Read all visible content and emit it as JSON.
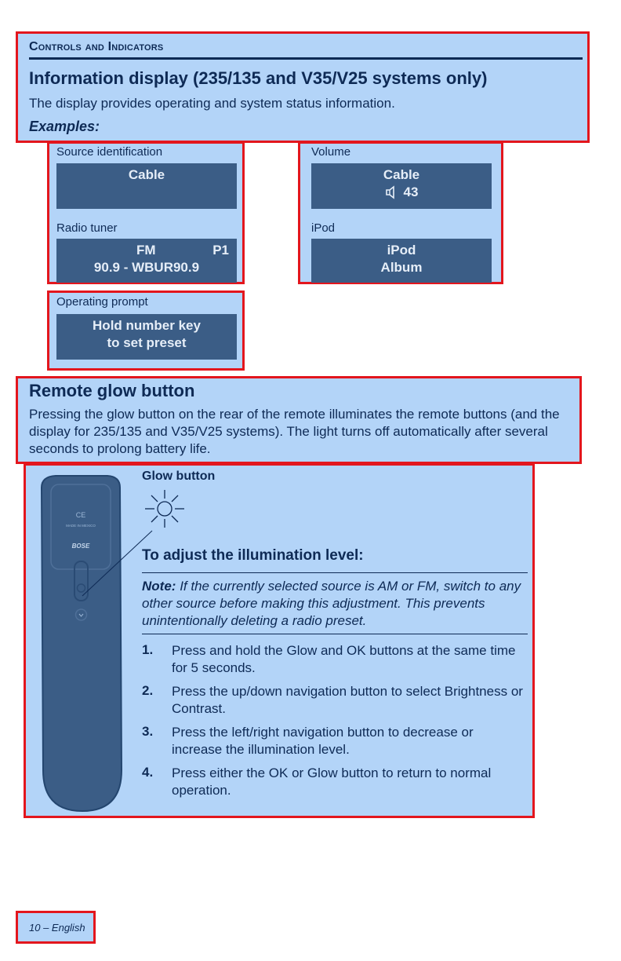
{
  "header": {
    "section_title": "Controls and Indicators",
    "heading": "Information display (235/135 and V35/V25 systems only)",
    "intro": "The display provides operating and system status information.",
    "examples_label": "Examples:"
  },
  "examples": {
    "source": {
      "label": "Source identification",
      "line1": "Cable",
      "line2": ""
    },
    "volume": {
      "label": "Volume",
      "line1": "Cable",
      "line2": "43",
      "icon": "speaker-icon"
    },
    "radio": {
      "label": "Radio tuner",
      "line1_left": "FM",
      "line1_right": "P1",
      "line2": "90.9 - WBUR90.9"
    },
    "ipod": {
      "label": "iPod",
      "line1": "iPod",
      "line2": "Album"
    },
    "prompt": {
      "label": "Operating prompt",
      "line1": "Hold number key",
      "line2": "to set preset"
    }
  },
  "glow": {
    "heading": "Remote glow button",
    "body": "Pressing the glow button on the rear of the remote illuminates the remote buttons (and the display for 235/135 and V35/V25 systems). The light turns off automatically after several seconds to prolong battery life."
  },
  "figure": {
    "glow_button_label": "Glow button",
    "remote_ce": "CE",
    "remote_made_in": "MADE IN MEXICO",
    "remote_brand": "BOSE",
    "adjust_heading": "To adjust the illumination level:",
    "note_label": "Note:",
    "note_text": "If the currently selected source is AM or FM, switch to any other source before making this adjustment. This prevents unintentionally deleting a radio preset.",
    "steps": [
      {
        "num": "1.",
        "text": "Press and hold the Glow and OK buttons at the same time for 5 seconds."
      },
      {
        "num": "2.",
        "text": "Press the up/down navigation button to select Brightness or Contrast."
      },
      {
        "num": "3.",
        "text": "Press the left/right navigation button to decrease or increase the illumination level."
      },
      {
        "num": "4.",
        "text": "Press either the OK or Glow button to return to normal operation."
      }
    ]
  },
  "footer": {
    "page": "10 – English"
  },
  "colors": {
    "highlight": "#b3d4f8",
    "border": "#e3161d",
    "panel": "#3b5d86",
    "text": "#0e2a55"
  }
}
